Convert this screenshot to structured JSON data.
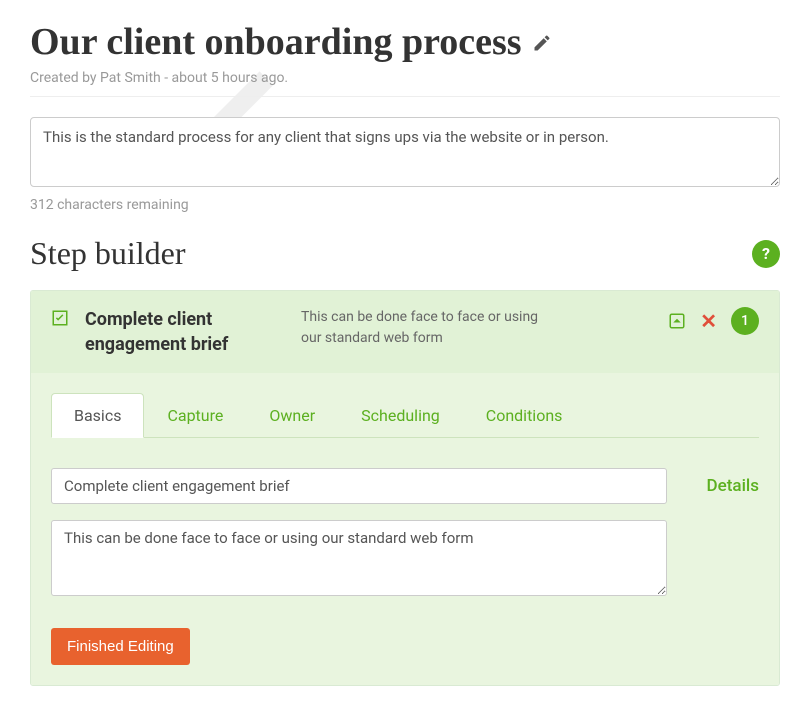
{
  "title": "Our client onboarding process",
  "meta": "Created by Pat Smith - about 5 hours ago.",
  "description_value": "This is the standard process for any client that signs ups via the website or in person.",
  "char_remaining": "312 characters remaining",
  "section_title": "Step builder",
  "help_label": "?",
  "step": {
    "number": "1",
    "title": "Complete client engagement brief",
    "desc": "This can be done face to face or using our standard web form",
    "tabs": {
      "basics": "Basics",
      "capture": "Capture",
      "owner": "Owner",
      "scheduling": "Scheduling",
      "conditions": "Conditions"
    },
    "details_label": "Details",
    "name_input": "Complete client engagement brief",
    "desc_input": "This can be done face to face or using our standard web form",
    "finished_label": "Finished Editing"
  }
}
